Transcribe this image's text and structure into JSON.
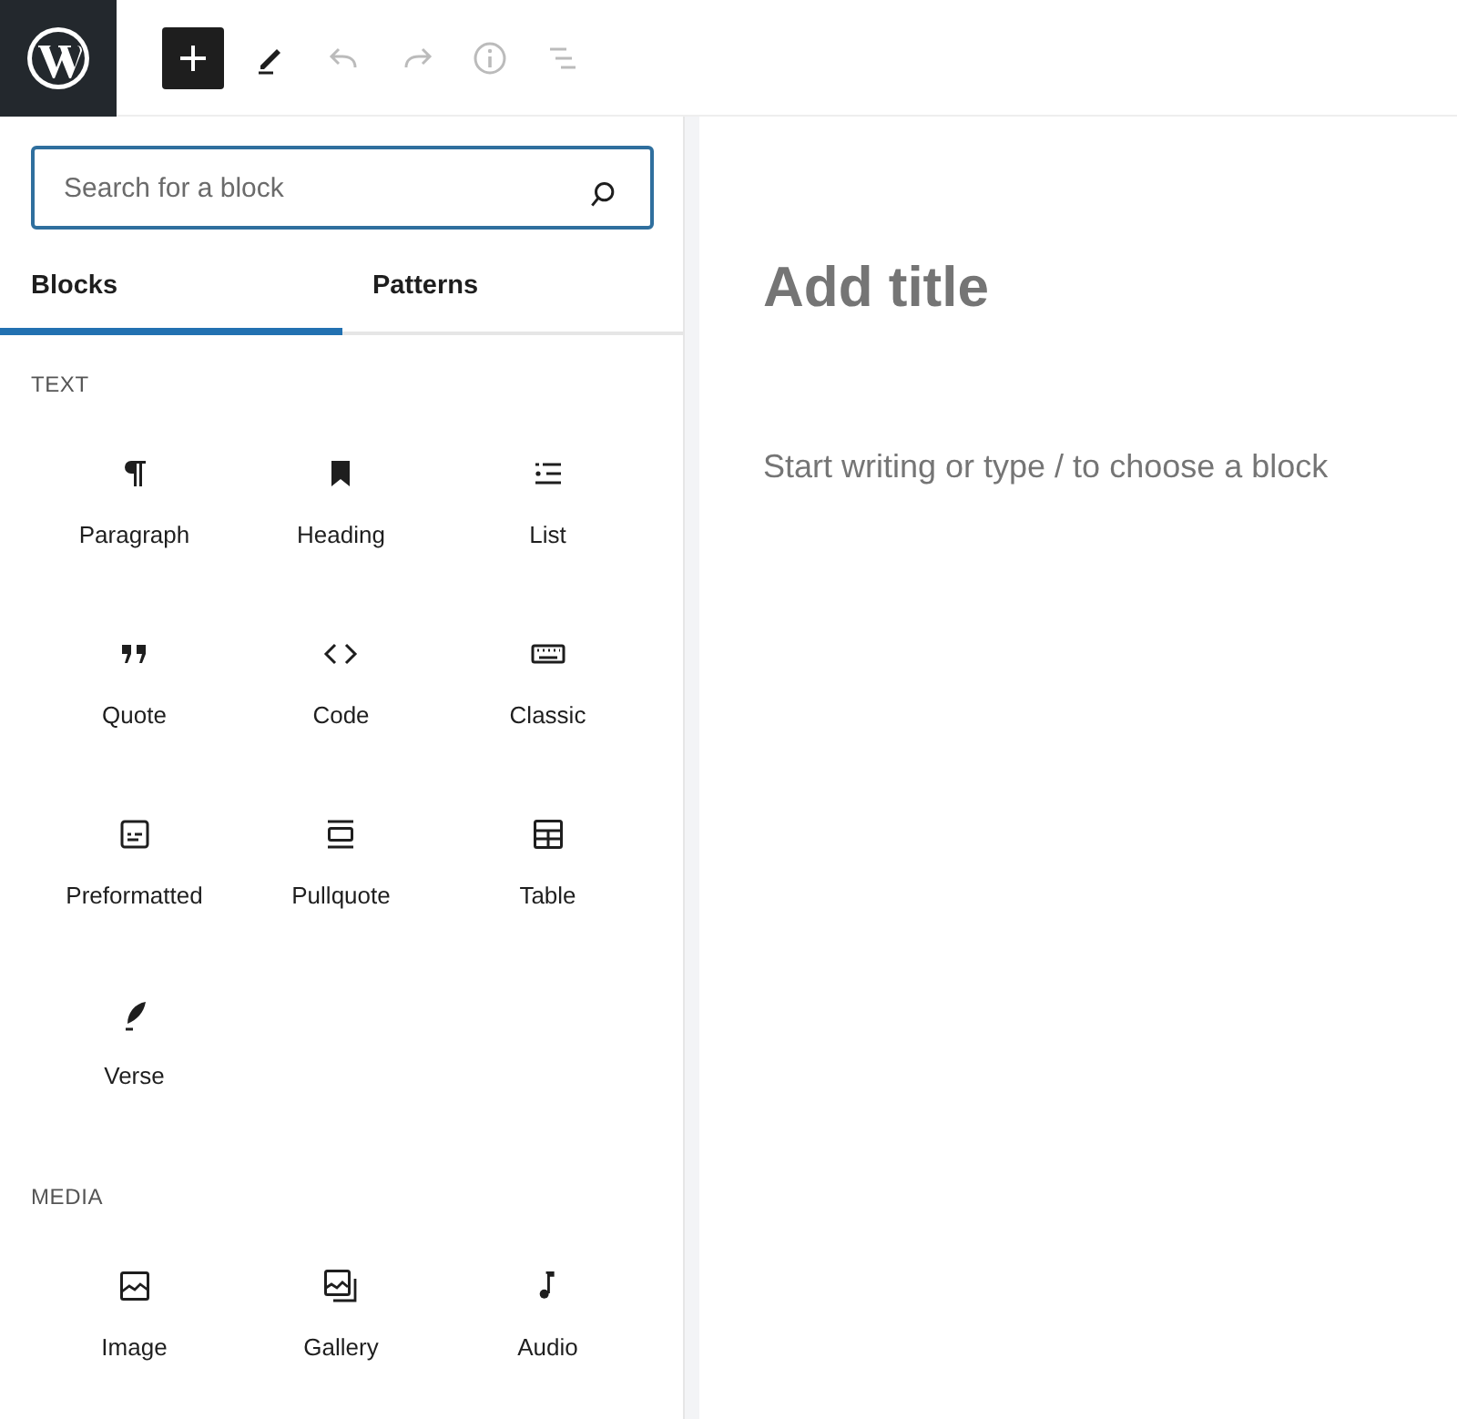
{
  "toolbar": [
    {
      "kind": "add",
      "pressed": true,
      "disabled": false
    },
    {
      "kind": "edit",
      "pressed": false,
      "disabled": false
    },
    {
      "kind": "undo",
      "pressed": false,
      "disabled": true
    },
    {
      "kind": "redo",
      "pressed": false,
      "disabled": true
    },
    {
      "kind": "info",
      "pressed": false,
      "disabled": true
    },
    {
      "kind": "outline",
      "pressed": false,
      "disabled": true
    }
  ],
  "search": {
    "placeholder": "Search for a block"
  },
  "tabs": [
    {
      "label": "Blocks",
      "selected": true
    },
    {
      "label": "Patterns",
      "selected": false
    }
  ],
  "categories": [
    {
      "title": "TEXT",
      "blocks": [
        {
          "kind": "paragraph",
          "label": "Paragraph"
        },
        {
          "kind": "heading",
          "label": "Heading"
        },
        {
          "kind": "list",
          "label": "List"
        },
        {
          "kind": "quote",
          "label": "Quote"
        },
        {
          "kind": "code",
          "label": "Code"
        },
        {
          "kind": "classic",
          "label": "Classic"
        },
        {
          "kind": "preformatted",
          "label": "Preformatted"
        },
        {
          "kind": "pullquote",
          "label": "Pullquote"
        },
        {
          "kind": "table",
          "label": "Table"
        },
        {
          "kind": "verse",
          "label": "Verse"
        }
      ]
    },
    {
      "title": "MEDIA",
      "blocks": [
        {
          "kind": "image",
          "label": "Image"
        },
        {
          "kind": "gallery",
          "label": "Gallery"
        },
        {
          "kind": "audio",
          "label": "Audio"
        }
      ]
    }
  ],
  "editor": {
    "title_placeholder": "Add title",
    "body_placeholder": "Start writing or type / to choose a block"
  }
}
